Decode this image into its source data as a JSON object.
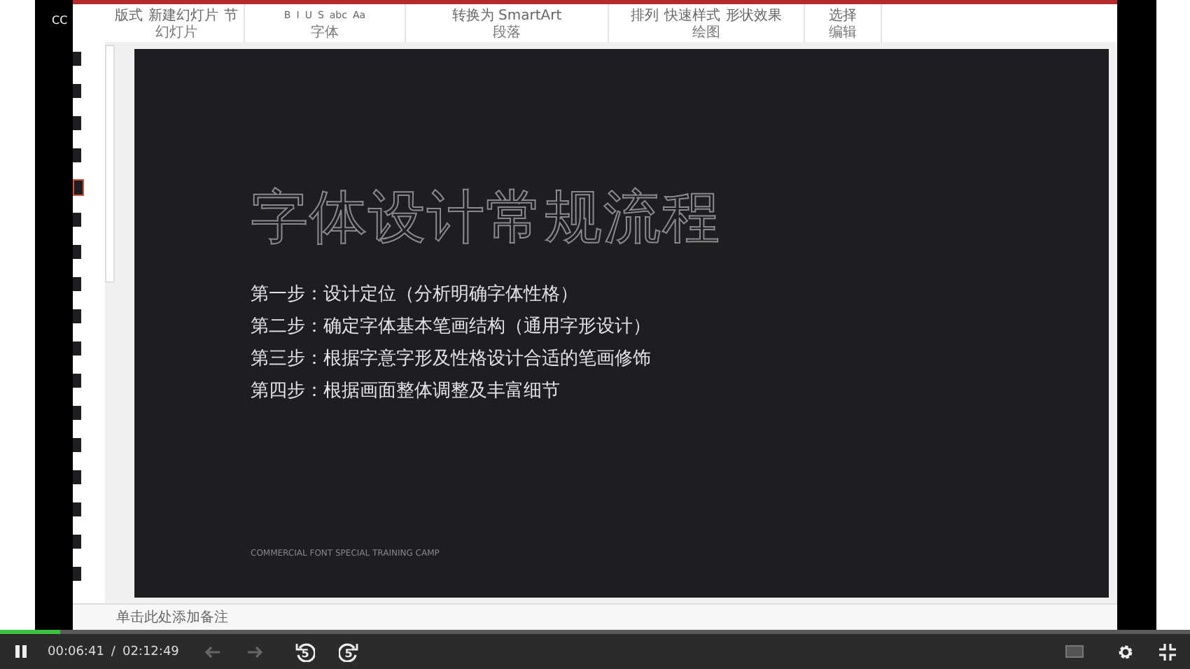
{
  "overlay_text": "CC",
  "ribbon": {
    "groups": [
      {
        "label": "幻灯片",
        "items": [
          "版式",
          "新建幻灯片",
          "节"
        ]
      },
      {
        "label": "字体",
        "items": [
          "B",
          "I",
          "U",
          "S",
          "abc",
          "Aa"
        ]
      },
      {
        "label": "段落",
        "items": [
          "转换为 SmartArt"
        ]
      },
      {
        "label": "绘图",
        "items": [
          "排列",
          "快速样式",
          "形状效果"
        ]
      },
      {
        "label": "编辑",
        "items": [
          "选择"
        ]
      }
    ]
  },
  "thumbnails": [
    {
      "selected": false
    },
    {
      "selected": false
    },
    {
      "selected": false
    },
    {
      "selected": false
    },
    {
      "selected": true
    },
    {
      "selected": false
    },
    {
      "selected": false
    },
    {
      "selected": false
    },
    {
      "selected": false
    },
    {
      "selected": false
    },
    {
      "selected": false
    },
    {
      "selected": false
    },
    {
      "selected": false
    },
    {
      "selected": false
    },
    {
      "selected": false
    },
    {
      "selected": false
    },
    {
      "selected": false
    }
  ],
  "slide": {
    "title": "字体设计常规流程",
    "steps": [
      "第一步：设计定位（分析明确字体性格）",
      "第二步：确定字体基本笔画结构（通用字形设计）",
      "第三步：根据字意字形及性格设计合适的笔画修饰",
      "第四步：根据画面整体调整及丰富细节"
    ],
    "footer": "COMMERCIAL FONT SPECIAL TRAINING CAMP"
  },
  "notes": {
    "placeholder": "单击此处添加备注"
  },
  "player": {
    "playing": true,
    "level": 0.05,
    "current_time": "00:06:41",
    "separator": "/",
    "total_time": "02:12:49",
    "rewind_seconds": "5",
    "forward_seconds": "5"
  }
}
